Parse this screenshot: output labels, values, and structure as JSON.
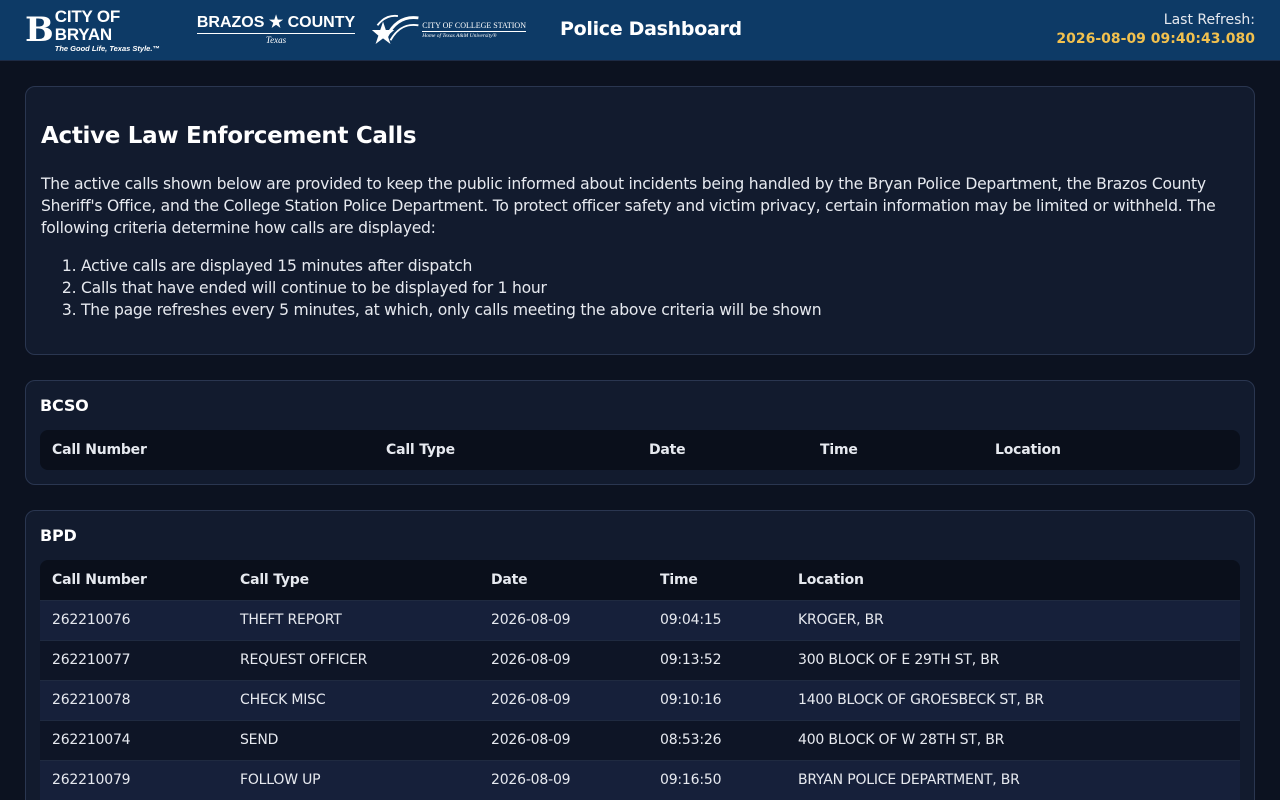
{
  "header": {
    "logos": {
      "bryan_letter": "B",
      "bryan_name": "CITY OF BRYAN",
      "bryan_tagline": "The Good Life, Texas Style.™",
      "brazos_name": "BRAZOS ★ COUNTY",
      "brazos_sub": "Texas",
      "cs_name": "CITY OF COLLEGE STATION",
      "cs_tagline": "Home of Texas A&M University®"
    },
    "title": "Police Dashboard",
    "refresh_label": "Last Refresh:",
    "refresh_value": "2026-08-09 09:40:43.080"
  },
  "intro": {
    "title": "Active Law Enforcement Calls",
    "description": "The active calls shown below are provided to keep the public informed about incidents being handled by the Bryan Police Department, the Brazos County Sheriff's Office, and the College Station Police Department. To protect officer safety and victim privacy, certain information may be limited or withheld. The following criteria determine how calls are displayed:",
    "criteria": [
      "Active calls are displayed 15 minutes after dispatch",
      "Calls that have ended will continue to be displayed for 1 hour",
      "The page refreshes every 5 minutes, at which, only calls meeting the above criteria will be shown"
    ]
  },
  "columns": [
    "Call Number",
    "Call Type",
    "Date",
    "Time",
    "Location"
  ],
  "bcso": {
    "title": "BCSO",
    "rows": []
  },
  "bpd": {
    "title": "BPD",
    "rows": [
      [
        "262210076",
        "THEFT REPORT",
        "2026-08-09",
        "09:04:15",
        "KROGER, BR"
      ],
      [
        "262210077",
        "REQUEST OFFICER",
        "2026-08-09",
        "09:13:52",
        "300 BLOCK OF E 29TH ST, BR"
      ],
      [
        "262210078",
        "CHECK MISC",
        "2026-08-09",
        "09:10:16",
        "1400 BLOCK OF GROESBECK ST, BR"
      ],
      [
        "262210074",
        "SEND",
        "2026-08-09",
        "08:53:26",
        "400 BLOCK OF W 28TH ST, BR"
      ],
      [
        "262210079",
        "FOLLOW UP",
        "2026-08-09",
        "09:16:50",
        "BRYAN POLICE DEPARTMENT, BR"
      ]
    ]
  },
  "colors": {
    "header_bg": "#0d3a66",
    "page_bg": "#0c1220",
    "card_bg": "#121b2e",
    "refresh_accent": "#f2c14e"
  }
}
